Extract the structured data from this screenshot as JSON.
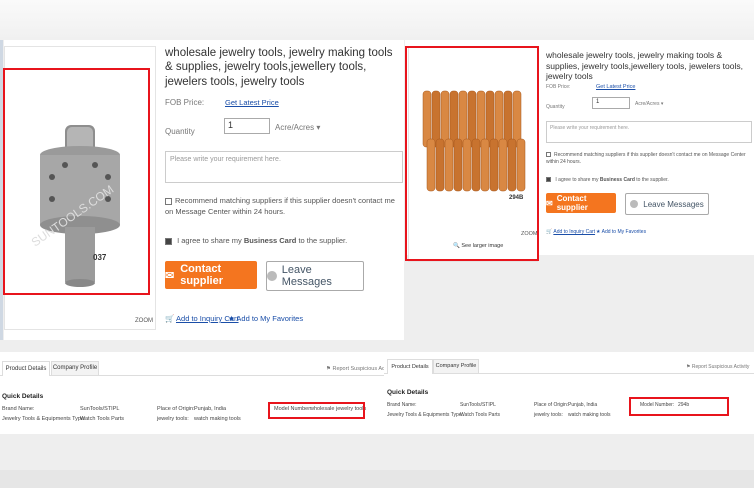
{
  "left": {
    "title": "wholesale jewelry tools, jewelry making tools & supplies, jewelry tools,jewellery tools, jewelers tools, jewelry tools",
    "fob_label": "FOB Price:",
    "fob_link": "Get Latest Price",
    "qty_label": "Quantity",
    "qty_value": "1",
    "unit": "Acre/Acres",
    "textarea_placeholder": "Please write your requirement here.",
    "recommend_text": "Recommend matching suppliers if this supplier doesn't contact me on Message Center within 24 hours.",
    "agree_text_pre": "I agree to share my",
    "agree_bold": "Business Card",
    "agree_text_post": "to the supplier.",
    "contact_btn": "Contact supplier",
    "leave_btn": "Leave Messages",
    "inquiry_link": "Add to Inquiry Cart",
    "favorites_link": "Add to My Favorites",
    "image_label": "037",
    "watermark": "SUNTOOLS.COM",
    "zoom": "ZOOM",
    "tab_details": "Product Details",
    "tab_profile": "Company Profile",
    "report": "Report Suspicious Activ",
    "quick_details": "Quick Details",
    "brand_label": "Brand Name:",
    "brand_value": "SunTools/STIPL",
    "type_label": "Jewelry Tools & Equipments Type:",
    "type_value": "Watch Tools Parts",
    "origin_label": "Place of Origin:",
    "origin_value": "Punjab, India",
    "jtools_label": "jewelry tools:",
    "jtools_value": "watch making tools",
    "model_label": "Model Number:",
    "model_value": "wholesale jewelry tools"
  },
  "right": {
    "title": "wholesale jewelry tools, jewelry making tools & supplies, jewelry tools,jewellery tools, jewelers tools, jewelry tools",
    "fob_label": "FOB Price:",
    "fob_link": "Get Latest Price",
    "qty_label": "Quantity",
    "qty_value": "1",
    "unit": "Acre/Acres",
    "textarea_placeholder": "Please write your requirement here.",
    "recommend_text": "Recommend matching suppliers if this supplier doesn't contact me on Message Center within 24 hours.",
    "agree_text_pre": "I agree to share my",
    "agree_bold": "Business Card",
    "agree_text_post": "to the supplier.",
    "contact_btn": "Contact supplier",
    "leave_btn": "Leave Messages",
    "inquiry_link": "Add to Inquiry Cart",
    "favorites_link": "Add to My Favorites",
    "image_label": "294B",
    "watermark": "SUNTOOLS.COM",
    "zoom": "ZOOM",
    "see_larger": "See larger image",
    "tab_details": "Product Details",
    "tab_profile": "Company Profile",
    "report": "Report Suspicious Activity",
    "quick_details": "Quick Details",
    "brand_label": "Brand Name:",
    "brand_value": "SunTools/STIPL",
    "type_label": "Jewelry Tools & Equipments Type:",
    "type_value": "Watch Tools Parts",
    "origin_label": "Place of Origin:",
    "origin_value": "Punjab, India",
    "jtools_label": "jewelry tools:",
    "jtools_value": "watch making tools",
    "model_label": "Model Number:",
    "model_value": "294b"
  },
  "colors": {
    "highlight": "#e8141c",
    "accent": "#f4751f",
    "link": "#1a4ea8"
  }
}
